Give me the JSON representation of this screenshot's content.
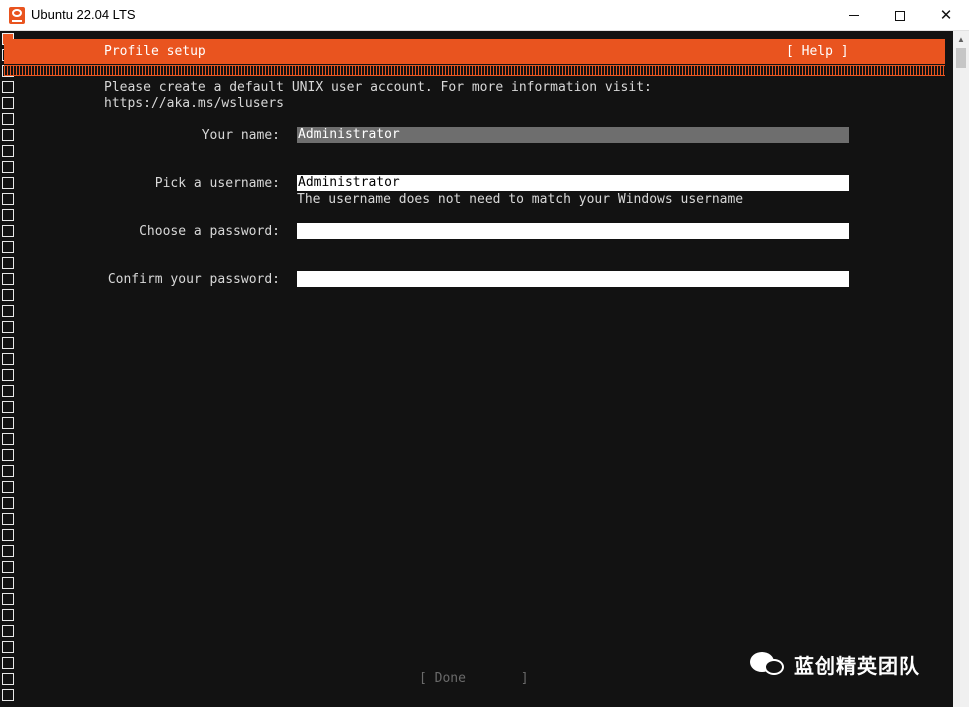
{
  "window": {
    "title": "Ubuntu 22.04 LTS",
    "accent_color": "#e9541f",
    "icon": "ubuntu-app-icon"
  },
  "header": {
    "title": "Profile setup",
    "help_label": "[ Help ]"
  },
  "intro": {
    "text": "Please create a default UNIX user account. For more information visit:\nhttps://aka.ms/wslusers"
  },
  "form": {
    "name_label": "Your name:",
    "name_value": "Administrator",
    "username_label": "Pick a username:",
    "username_value": "Administrator",
    "username_hint": "The username does not need to match your Windows username",
    "password_label": "Choose a password:",
    "password_value": "",
    "confirm_label": "Confirm your password:",
    "confirm_value": ""
  },
  "footer": {
    "done_label": "[ Done       ]"
  },
  "watermark": {
    "text": "蓝创精英团队"
  }
}
